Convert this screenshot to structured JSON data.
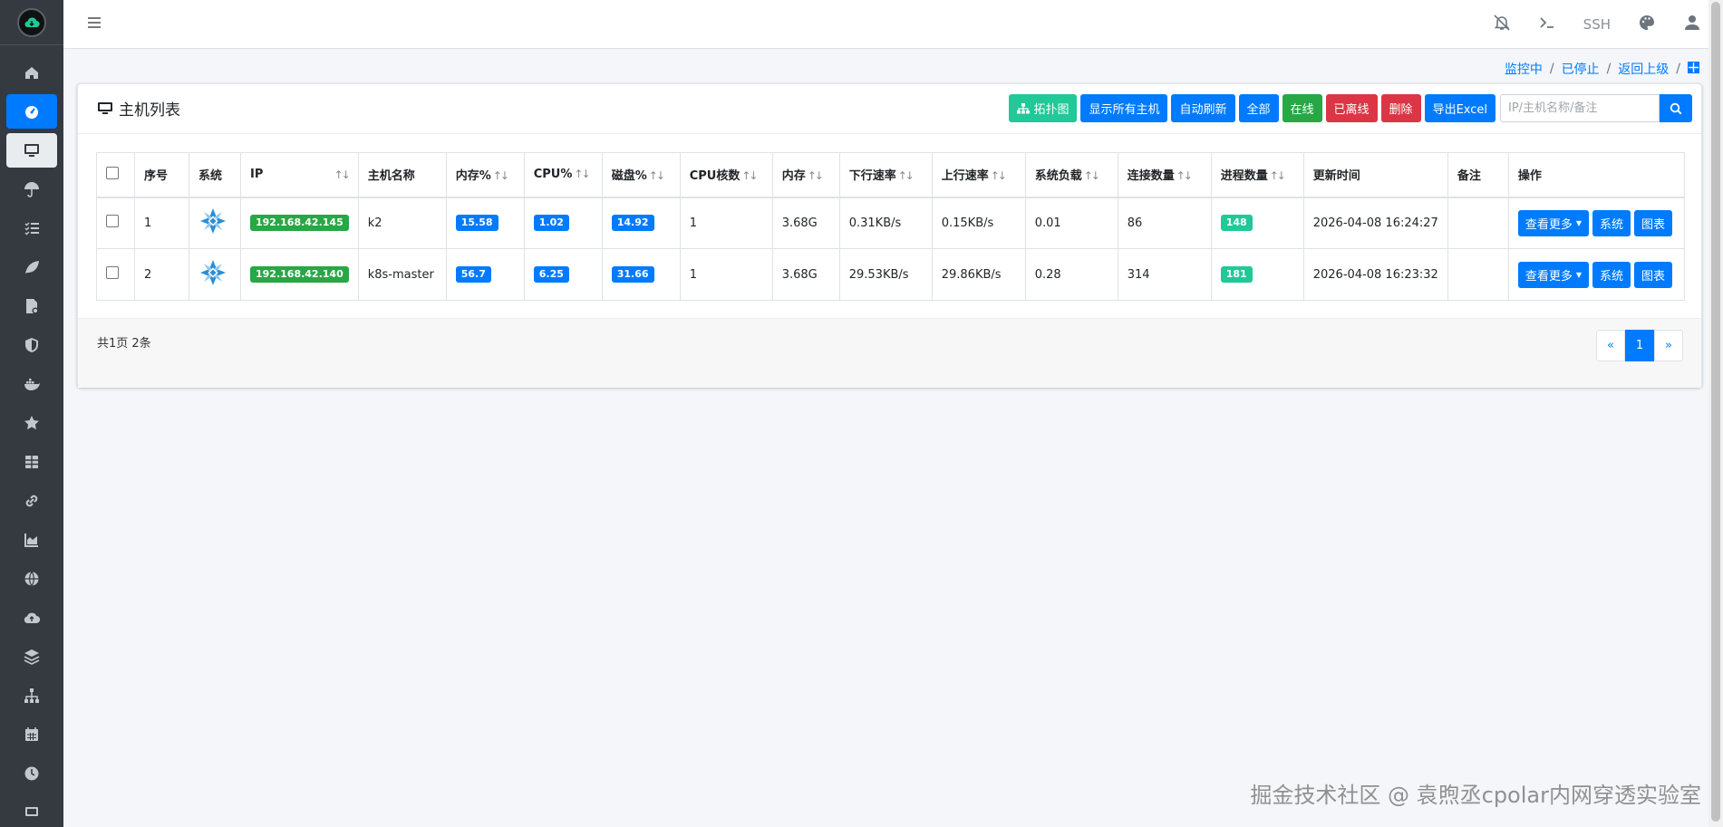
{
  "sidebar": {
    "items": [
      {
        "icon": "home-icon"
      },
      {
        "icon": "dashboard-icon",
        "state": "active"
      },
      {
        "icon": "desktop-icon",
        "state": "current"
      },
      {
        "icon": "umbrella-icon"
      },
      {
        "icon": "list-check-icon"
      },
      {
        "icon": "leaf-icon"
      },
      {
        "icon": "file-settings-icon"
      },
      {
        "icon": "shield-icon"
      },
      {
        "icon": "docker-icon"
      },
      {
        "icon": "star-icon"
      },
      {
        "icon": "table-icon"
      },
      {
        "icon": "link-icon"
      },
      {
        "icon": "area-chart-icon"
      },
      {
        "icon": "globe-icon"
      },
      {
        "icon": "cloud-upload-icon"
      },
      {
        "icon": "layers-icon"
      },
      {
        "icon": "sitemap-icon"
      },
      {
        "icon": "calendar-icon"
      },
      {
        "icon": "clock-icon"
      },
      {
        "icon": "monitor-icon"
      }
    ]
  },
  "topbar": {
    "ssh_label": "SSH"
  },
  "breadcrumb": {
    "items": [
      "监控中",
      "已停止",
      "返回上级"
    ]
  },
  "card": {
    "title": "主机列表",
    "buttons": {
      "topology": "拓扑图",
      "show_all": "显示所有主机",
      "auto_refresh": "自动刷新",
      "all": "全部",
      "online": "在线",
      "offline": "已离线",
      "delete": "删除",
      "export": "导出Excel"
    },
    "search_placeholder": "IP/主机名称/备注"
  },
  "table": {
    "headers": {
      "seq": "序号",
      "os": "系统",
      "ip": "IP",
      "hostname": "主机名称",
      "mem_pct": "内存%",
      "cpu_pct": "CPU%",
      "disk_pct": "磁盘%",
      "cpu_cores": "CPU核数",
      "memory": "内存",
      "down_rate": "下行速率",
      "up_rate": "上行速率",
      "load": "系统负载",
      "connections": "连接数量",
      "processes": "进程数量",
      "updated": "更新时间",
      "notes": "备注",
      "actions": "操作"
    },
    "rows": [
      {
        "seq": "1",
        "ip": "192.168.42.145",
        "hostname": "k2",
        "mem_pct": "15.58",
        "cpu_pct": "1.02",
        "disk_pct": "14.92",
        "cpu_cores": "1",
        "memory": "3.68G",
        "down_rate": "0.31KB/s",
        "up_rate": "0.15KB/s",
        "load": "0.01",
        "connections": "86",
        "processes": "148",
        "updated": "2026-04-08 16:24:27",
        "notes": ""
      },
      {
        "seq": "2",
        "ip": "192.168.42.140",
        "hostname": "k8s-master",
        "mem_pct": "56.7",
        "cpu_pct": "6.25",
        "disk_pct": "31.66",
        "cpu_cores": "1",
        "memory": "3.68G",
        "down_rate": "29.53KB/s",
        "up_rate": "29.86KB/s",
        "load": "0.28",
        "connections": "314",
        "processes": "181",
        "updated": "2026-04-08 16:23:32",
        "notes": ""
      }
    ],
    "row_actions": {
      "more": "查看更多",
      "system": "系统",
      "chart": "图表"
    }
  },
  "pagination": {
    "summary": "共1页 2条",
    "prev": "«",
    "current": "1",
    "next": "»"
  },
  "watermark": "掘金技术社区 @ 袁煦丞cpolar内网穿透实验室",
  "colors": {
    "primary": "#007bff",
    "success": "#28a745",
    "danger": "#dc3545",
    "teal": "#20c997",
    "sidebar": "#343a40"
  }
}
